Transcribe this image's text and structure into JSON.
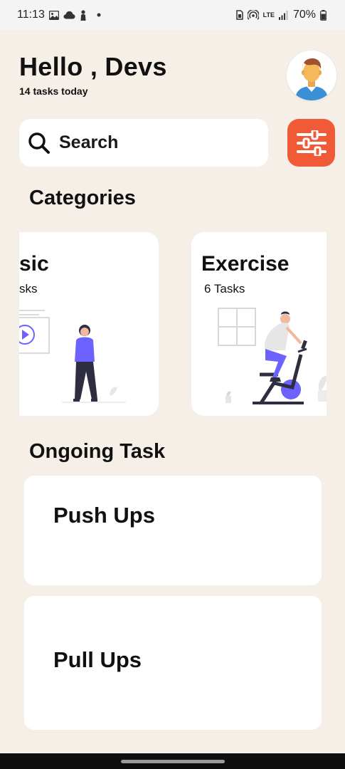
{
  "status_bar": {
    "time": "11:13",
    "battery": "70%",
    "network": "LTE",
    "icons": [
      "gallery-icon",
      "cloud-icon",
      "person-icon",
      "dot-icon",
      "sim-icon",
      "hotspot-icon",
      "signal-icon",
      "battery-icon"
    ]
  },
  "header": {
    "greeting": "Hello , Devs",
    "subtitle": "14 tasks today"
  },
  "search": {
    "label": "Search",
    "icon": "search-icon"
  },
  "filter": {
    "icon": "sliders-icon",
    "color": "#f05a37"
  },
  "categories": {
    "title": "Categories",
    "items": [
      {
        "title": "sic",
        "count": "sks"
      },
      {
        "title": "Exercise",
        "count": "6 Tasks"
      }
    ]
  },
  "ongoing": {
    "title": "Ongoing Task",
    "tasks": [
      {
        "title": "Push Ups"
      },
      {
        "title": "Pull Ups"
      }
    ]
  },
  "colors": {
    "background": "#f6efe8",
    "accent": "#f05a37",
    "illustration": "#6c63ff"
  }
}
